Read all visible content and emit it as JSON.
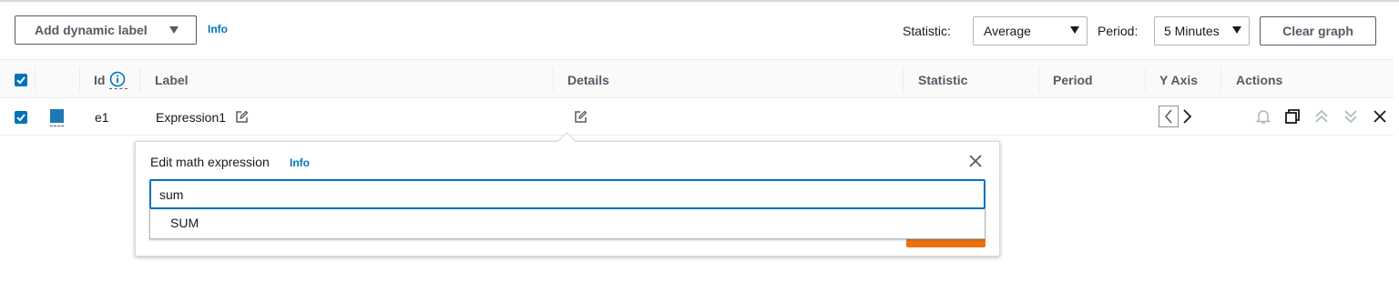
{
  "toolbar": {
    "dynamic_label_button": "Add dynamic label",
    "info_link": "Info",
    "statistic_label": "Statistic:",
    "statistic_value": "Average",
    "period_label": "Period:",
    "period_value": "5 Minutes",
    "clear_graph_button": "Clear graph"
  },
  "table": {
    "headers": {
      "id": "Id",
      "label": "Label",
      "details": "Details",
      "statistic": "Statistic",
      "period": "Period",
      "y_axis": "Y Axis",
      "actions": "Actions"
    },
    "rows": [
      {
        "checked": true,
        "color": "#1f77b4",
        "id": "e1",
        "label": "Expression1",
        "details": "",
        "statistic": "",
        "period": ""
      }
    ]
  },
  "popover": {
    "title": "Edit math expression",
    "info_link": "Info",
    "input_value": "sum",
    "suggestions": [
      "SUM"
    ]
  },
  "colors": {
    "accent": "#0073bb",
    "primary_button": "#ec7211",
    "series": "#1f77b4"
  },
  "icons": {
    "info_circle": "info-circle-icon",
    "edit": "edit-icon",
    "close": "close-icon",
    "chevron_left": "chevron-left-icon",
    "chevron_right": "chevron-right-icon",
    "bell": "bell-icon",
    "duplicate": "duplicate-icon",
    "move_up": "double-chevron-up-icon",
    "move_down": "double-chevron-down-icon",
    "remove": "close-icon"
  }
}
